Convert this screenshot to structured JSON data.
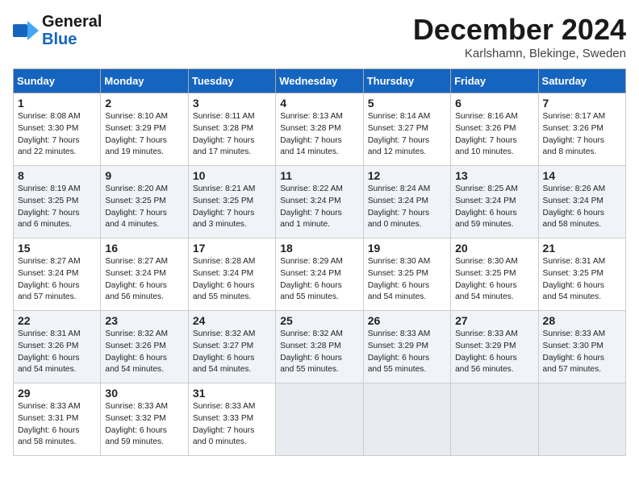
{
  "logo": {
    "line1": "General",
    "line2": "Blue"
  },
  "title": "December 2024",
  "subtitle": "Karlshamn, Blekinge, Sweden",
  "headers": [
    "Sunday",
    "Monday",
    "Tuesday",
    "Wednesday",
    "Thursday",
    "Friday",
    "Saturday"
  ],
  "weeks": [
    [
      {
        "day": "1",
        "lines": [
          "Sunrise: 8:08 AM",
          "Sunset: 3:30 PM",
          "Daylight: 7 hours",
          "and 22 minutes."
        ]
      },
      {
        "day": "2",
        "lines": [
          "Sunrise: 8:10 AM",
          "Sunset: 3:29 PM",
          "Daylight: 7 hours",
          "and 19 minutes."
        ]
      },
      {
        "day": "3",
        "lines": [
          "Sunrise: 8:11 AM",
          "Sunset: 3:28 PM",
          "Daylight: 7 hours",
          "and 17 minutes."
        ]
      },
      {
        "day": "4",
        "lines": [
          "Sunrise: 8:13 AM",
          "Sunset: 3:28 PM",
          "Daylight: 7 hours",
          "and 14 minutes."
        ]
      },
      {
        "day": "5",
        "lines": [
          "Sunrise: 8:14 AM",
          "Sunset: 3:27 PM",
          "Daylight: 7 hours",
          "and 12 minutes."
        ]
      },
      {
        "day": "6",
        "lines": [
          "Sunrise: 8:16 AM",
          "Sunset: 3:26 PM",
          "Daylight: 7 hours",
          "and 10 minutes."
        ]
      },
      {
        "day": "7",
        "lines": [
          "Sunrise: 8:17 AM",
          "Sunset: 3:26 PM",
          "Daylight: 7 hours",
          "and 8 minutes."
        ]
      }
    ],
    [
      {
        "day": "8",
        "lines": [
          "Sunrise: 8:19 AM",
          "Sunset: 3:25 PM",
          "Daylight: 7 hours",
          "and 6 minutes."
        ]
      },
      {
        "day": "9",
        "lines": [
          "Sunrise: 8:20 AM",
          "Sunset: 3:25 PM",
          "Daylight: 7 hours",
          "and 4 minutes."
        ]
      },
      {
        "day": "10",
        "lines": [
          "Sunrise: 8:21 AM",
          "Sunset: 3:25 PM",
          "Daylight: 7 hours",
          "and 3 minutes."
        ]
      },
      {
        "day": "11",
        "lines": [
          "Sunrise: 8:22 AM",
          "Sunset: 3:24 PM",
          "Daylight: 7 hours",
          "and 1 minute."
        ]
      },
      {
        "day": "12",
        "lines": [
          "Sunrise: 8:24 AM",
          "Sunset: 3:24 PM",
          "Daylight: 7 hours",
          "and 0 minutes."
        ]
      },
      {
        "day": "13",
        "lines": [
          "Sunrise: 8:25 AM",
          "Sunset: 3:24 PM",
          "Daylight: 6 hours",
          "and 59 minutes."
        ]
      },
      {
        "day": "14",
        "lines": [
          "Sunrise: 8:26 AM",
          "Sunset: 3:24 PM",
          "Daylight: 6 hours",
          "and 58 minutes."
        ]
      }
    ],
    [
      {
        "day": "15",
        "lines": [
          "Sunrise: 8:27 AM",
          "Sunset: 3:24 PM",
          "Daylight: 6 hours",
          "and 57 minutes."
        ]
      },
      {
        "day": "16",
        "lines": [
          "Sunrise: 8:27 AM",
          "Sunset: 3:24 PM",
          "Daylight: 6 hours",
          "and 56 minutes."
        ]
      },
      {
        "day": "17",
        "lines": [
          "Sunrise: 8:28 AM",
          "Sunset: 3:24 PM",
          "Daylight: 6 hours",
          "and 55 minutes."
        ]
      },
      {
        "day": "18",
        "lines": [
          "Sunrise: 8:29 AM",
          "Sunset: 3:24 PM",
          "Daylight: 6 hours",
          "and 55 minutes."
        ]
      },
      {
        "day": "19",
        "lines": [
          "Sunrise: 8:30 AM",
          "Sunset: 3:25 PM",
          "Daylight: 6 hours",
          "and 54 minutes."
        ]
      },
      {
        "day": "20",
        "lines": [
          "Sunrise: 8:30 AM",
          "Sunset: 3:25 PM",
          "Daylight: 6 hours",
          "and 54 minutes."
        ]
      },
      {
        "day": "21",
        "lines": [
          "Sunrise: 8:31 AM",
          "Sunset: 3:25 PM",
          "Daylight: 6 hours",
          "and 54 minutes."
        ]
      }
    ],
    [
      {
        "day": "22",
        "lines": [
          "Sunrise: 8:31 AM",
          "Sunset: 3:26 PM",
          "Daylight: 6 hours",
          "and 54 minutes."
        ]
      },
      {
        "day": "23",
        "lines": [
          "Sunrise: 8:32 AM",
          "Sunset: 3:26 PM",
          "Daylight: 6 hours",
          "and 54 minutes."
        ]
      },
      {
        "day": "24",
        "lines": [
          "Sunrise: 8:32 AM",
          "Sunset: 3:27 PM",
          "Daylight: 6 hours",
          "and 54 minutes."
        ]
      },
      {
        "day": "25",
        "lines": [
          "Sunrise: 8:32 AM",
          "Sunset: 3:28 PM",
          "Daylight: 6 hours",
          "and 55 minutes."
        ]
      },
      {
        "day": "26",
        "lines": [
          "Sunrise: 8:33 AM",
          "Sunset: 3:29 PM",
          "Daylight: 6 hours",
          "and 55 minutes."
        ]
      },
      {
        "day": "27",
        "lines": [
          "Sunrise: 8:33 AM",
          "Sunset: 3:29 PM",
          "Daylight: 6 hours",
          "and 56 minutes."
        ]
      },
      {
        "day": "28",
        "lines": [
          "Sunrise: 8:33 AM",
          "Sunset: 3:30 PM",
          "Daylight: 6 hours",
          "and 57 minutes."
        ]
      }
    ],
    [
      {
        "day": "29",
        "lines": [
          "Sunrise: 8:33 AM",
          "Sunset: 3:31 PM",
          "Daylight: 6 hours",
          "and 58 minutes."
        ]
      },
      {
        "day": "30",
        "lines": [
          "Sunrise: 8:33 AM",
          "Sunset: 3:32 PM",
          "Daylight: 6 hours",
          "and 59 minutes."
        ]
      },
      {
        "day": "31",
        "lines": [
          "Sunrise: 8:33 AM",
          "Sunset: 3:33 PM",
          "Daylight: 7 hours",
          "and 0 minutes."
        ]
      },
      null,
      null,
      null,
      null
    ]
  ]
}
